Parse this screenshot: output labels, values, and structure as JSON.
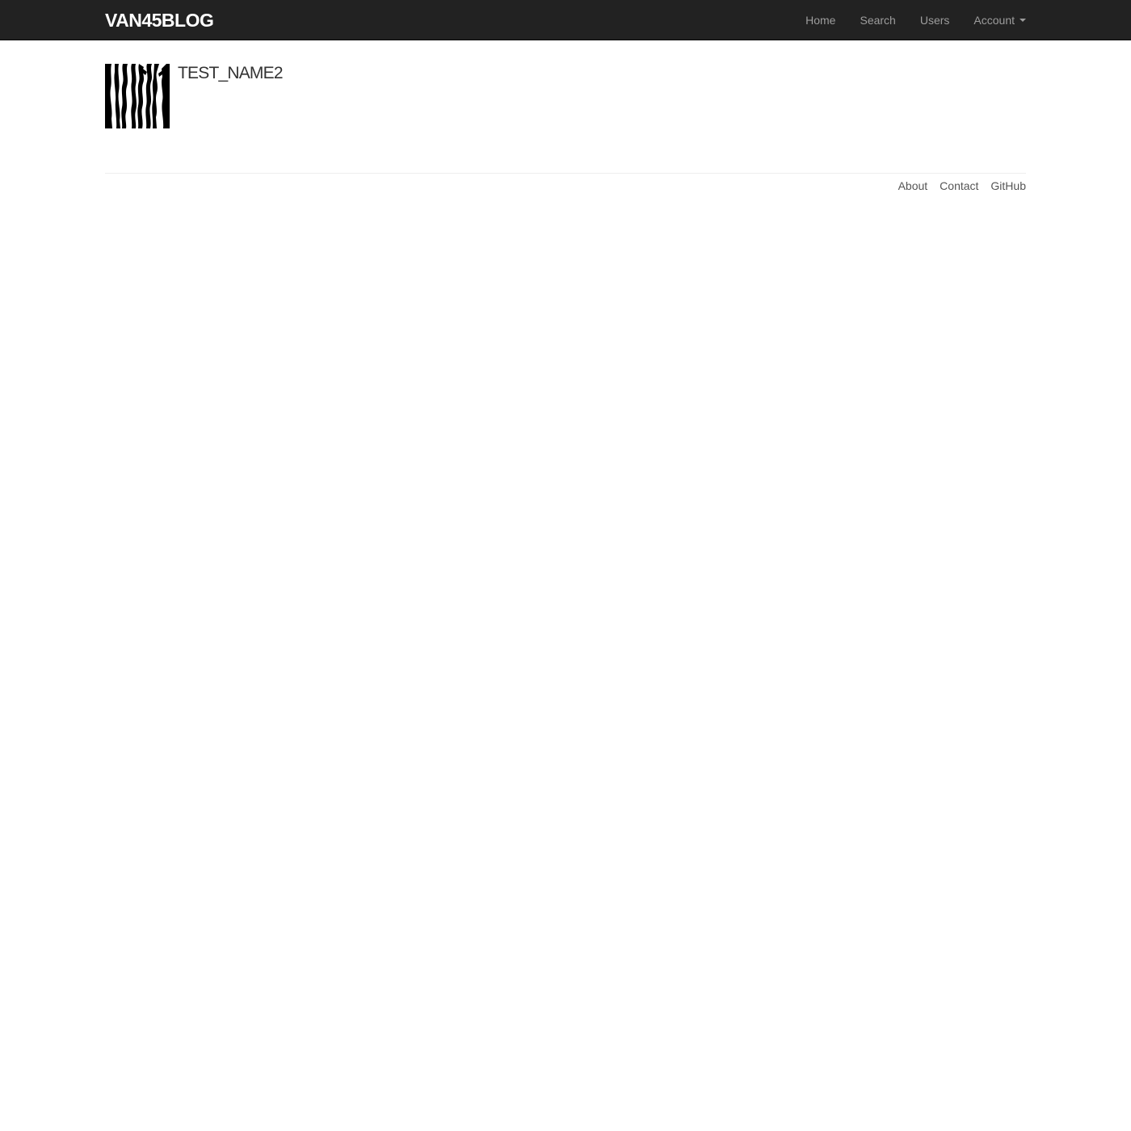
{
  "navbar": {
    "brand": "VAN45BLOG",
    "items": [
      {
        "label": "Home"
      },
      {
        "label": "Search"
      },
      {
        "label": "Users"
      },
      {
        "label": "Account"
      }
    ]
  },
  "profile": {
    "username": "TEST_NAME2",
    "avatar_icon": "zebra-stripes-avatar"
  },
  "footer": {
    "links": [
      {
        "label": "About"
      },
      {
        "label": "Contact"
      },
      {
        "label": "GitHub"
      }
    ]
  },
  "colors": {
    "navbar_bg": "#222222",
    "nav_link": "#9d9d9d",
    "brand": "#ffffff"
  }
}
